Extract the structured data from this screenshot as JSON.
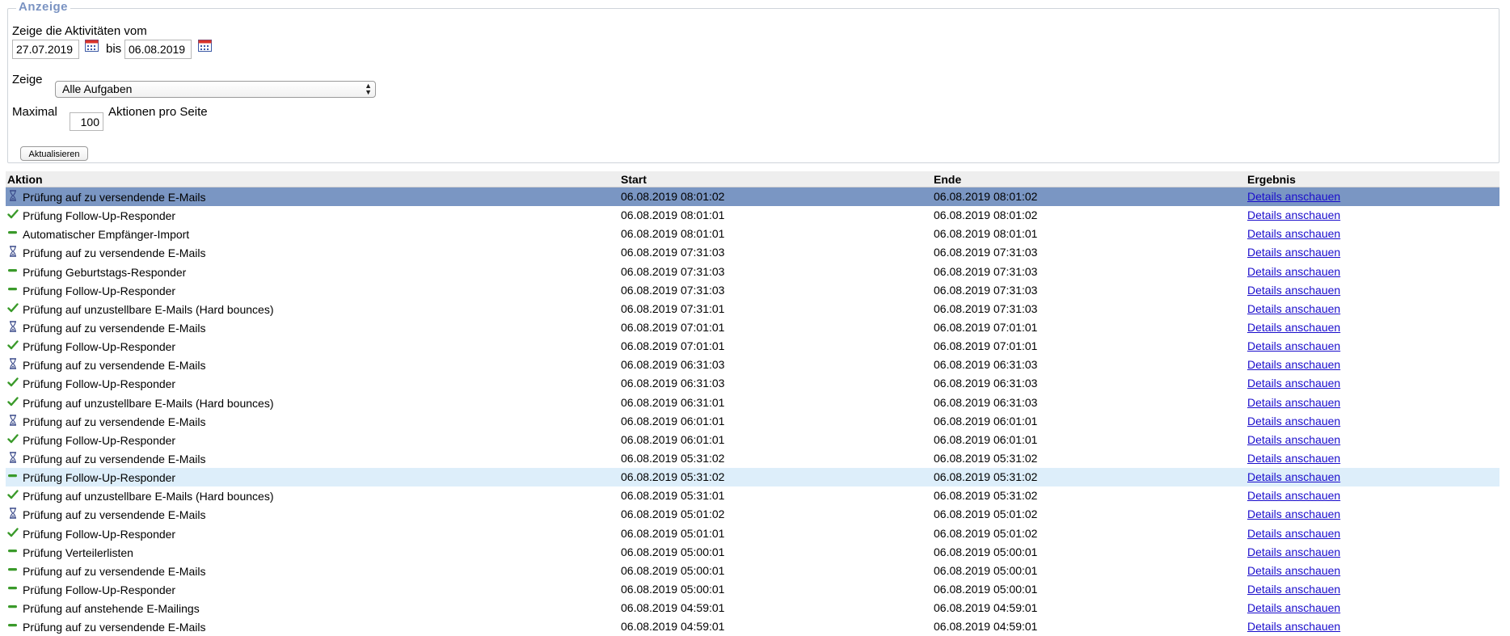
{
  "filter": {
    "legend": "Anzeige",
    "date_label": "Zeige die Aktivitäten vom",
    "date_from": "27.07.2019",
    "between_label": "bis",
    "date_to": "06.08.2019",
    "show_label": "Zeige",
    "show_value": "Alle Aufgaben",
    "max_label": "Maximal",
    "max_value": "100",
    "per_page_label": "Aktionen pro Seite",
    "refresh_button": "Aktualisieren"
  },
  "table": {
    "headers": {
      "aktion": "Aktion",
      "start": "Start",
      "ende": "Ende",
      "ergebnis": "Ergebnis"
    },
    "rows": [
      {
        "icon": "hourglass-icon",
        "aktion": "Prüfung auf zu versendende E-Mails",
        "start": "06.08.2019 08:01:02",
        "ende": "06.08.2019 08:01:02",
        "ergebnis": "Details anschauen",
        "state": "selected"
      },
      {
        "icon": "check-icon",
        "aktion": "Prüfung Follow-Up-Responder",
        "start": "06.08.2019 08:01:01",
        "ende": "06.08.2019 08:01:02",
        "ergebnis": "Details anschauen",
        "state": ""
      },
      {
        "icon": "dash-icon",
        "aktion": "Automatischer Empfänger-Import",
        "start": "06.08.2019 08:01:01",
        "ende": "06.08.2019 08:01:01",
        "ergebnis": "Details anschauen",
        "state": ""
      },
      {
        "icon": "hourglass-icon",
        "aktion": "Prüfung auf zu versendende E-Mails",
        "start": "06.08.2019 07:31:03",
        "ende": "06.08.2019 07:31:03",
        "ergebnis": "Details anschauen",
        "state": ""
      },
      {
        "icon": "dash-icon",
        "aktion": "Prüfung Geburtstags-Responder",
        "start": "06.08.2019 07:31:03",
        "ende": "06.08.2019 07:31:03",
        "ergebnis": "Details anschauen",
        "state": ""
      },
      {
        "icon": "dash-icon",
        "aktion": "Prüfung Follow-Up-Responder",
        "start": "06.08.2019 07:31:03",
        "ende": "06.08.2019 07:31:03",
        "ergebnis": "Details anschauen",
        "state": ""
      },
      {
        "icon": "check-icon",
        "aktion": "Prüfung auf unzustellbare E-Mails (Hard bounces)",
        "start": "06.08.2019 07:31:01",
        "ende": "06.08.2019 07:31:03",
        "ergebnis": "Details anschauen",
        "state": ""
      },
      {
        "icon": "hourglass-icon",
        "aktion": "Prüfung auf zu versendende E-Mails",
        "start": "06.08.2019 07:01:01",
        "ende": "06.08.2019 07:01:01",
        "ergebnis": "Details anschauen",
        "state": ""
      },
      {
        "icon": "check-icon",
        "aktion": "Prüfung Follow-Up-Responder",
        "start": "06.08.2019 07:01:01",
        "ende": "06.08.2019 07:01:01",
        "ergebnis": "Details anschauen",
        "state": ""
      },
      {
        "icon": "hourglass-icon",
        "aktion": "Prüfung auf zu versendende E-Mails",
        "start": "06.08.2019 06:31:03",
        "ende": "06.08.2019 06:31:03",
        "ergebnis": "Details anschauen",
        "state": ""
      },
      {
        "icon": "check-icon",
        "aktion": "Prüfung Follow-Up-Responder",
        "start": "06.08.2019 06:31:03",
        "ende": "06.08.2019 06:31:03",
        "ergebnis": "Details anschauen",
        "state": ""
      },
      {
        "icon": "check-icon",
        "aktion": "Prüfung auf unzustellbare E-Mails (Hard bounces)",
        "start": "06.08.2019 06:31:01",
        "ende": "06.08.2019 06:31:03",
        "ergebnis": "Details anschauen",
        "state": ""
      },
      {
        "icon": "hourglass-icon",
        "aktion": "Prüfung auf zu versendende E-Mails",
        "start": "06.08.2019 06:01:01",
        "ende": "06.08.2019 06:01:01",
        "ergebnis": "Details anschauen",
        "state": ""
      },
      {
        "icon": "check-icon",
        "aktion": "Prüfung Follow-Up-Responder",
        "start": "06.08.2019 06:01:01",
        "ende": "06.08.2019 06:01:01",
        "ergebnis": "Details anschauen",
        "state": ""
      },
      {
        "icon": "hourglass-icon",
        "aktion": "Prüfung auf zu versendende E-Mails",
        "start": "06.08.2019 05:31:02",
        "ende": "06.08.2019 05:31:02",
        "ergebnis": "Details anschauen",
        "state": ""
      },
      {
        "icon": "dash-icon",
        "aktion": "Prüfung Follow-Up-Responder",
        "start": "06.08.2019 05:31:02",
        "ende": "06.08.2019 05:31:02",
        "ergebnis": "Details anschauen",
        "state": "hover"
      },
      {
        "icon": "check-icon",
        "aktion": "Prüfung auf unzustellbare E-Mails (Hard bounces)",
        "start": "06.08.2019 05:31:01",
        "ende": "06.08.2019 05:31:02",
        "ergebnis": "Details anschauen",
        "state": ""
      },
      {
        "icon": "hourglass-icon",
        "aktion": "Prüfung auf zu versendende E-Mails",
        "start": "06.08.2019 05:01:02",
        "ende": "06.08.2019 05:01:02",
        "ergebnis": "Details anschauen",
        "state": ""
      },
      {
        "icon": "check-icon",
        "aktion": "Prüfung Follow-Up-Responder",
        "start": "06.08.2019 05:01:01",
        "ende": "06.08.2019 05:01:02",
        "ergebnis": "Details anschauen",
        "state": ""
      },
      {
        "icon": "dash-icon",
        "aktion": "Prüfung Verteilerlisten",
        "start": "06.08.2019 05:00:01",
        "ende": "06.08.2019 05:00:01",
        "ergebnis": "Details anschauen",
        "state": ""
      },
      {
        "icon": "dash-icon",
        "aktion": "Prüfung auf zu versendende E-Mails",
        "start": "06.08.2019 05:00:01",
        "ende": "06.08.2019 05:00:01",
        "ergebnis": "Details anschauen",
        "state": ""
      },
      {
        "icon": "dash-icon",
        "aktion": "Prüfung Follow-Up-Responder",
        "start": "06.08.2019 05:00:01",
        "ende": "06.08.2019 05:00:01",
        "ergebnis": "Details anschauen",
        "state": ""
      },
      {
        "icon": "dash-icon",
        "aktion": "Prüfung auf anstehende E-Mailings",
        "start": "06.08.2019 04:59:01",
        "ende": "06.08.2019 04:59:01",
        "ergebnis": "Details anschauen",
        "state": ""
      },
      {
        "icon": "dash-icon",
        "aktion": "Prüfung auf zu versendende E-Mails",
        "start": "06.08.2019 04:59:01",
        "ende": "06.08.2019 04:59:01",
        "ergebnis": "Details anschauen",
        "state": ""
      }
    ]
  },
  "colors": {
    "selected_row": "#7a96c3",
    "hover_row": "#ddeefa",
    "link": "#1a0dcc",
    "legend": "#7a93c2",
    "check": "#3a9a2a",
    "hourglass": "#3a4a8a"
  }
}
